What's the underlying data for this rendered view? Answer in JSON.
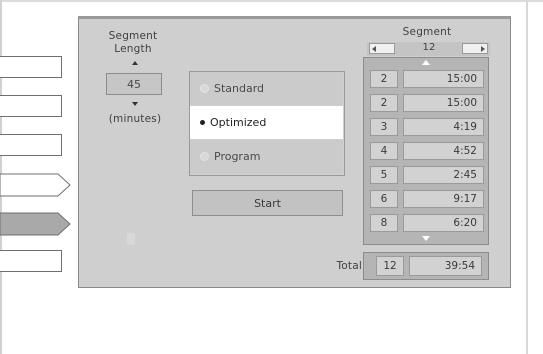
{
  "segment_length": {
    "title_line1": "Segment",
    "title_line2": "Length",
    "value": "45",
    "unit": "(minutes)"
  },
  "modes": [
    {
      "label": "Standard",
      "selected": false
    },
    {
      "label": "Optimized",
      "selected": true
    },
    {
      "label": "Program",
      "selected": false
    }
  ],
  "start_button": "Start",
  "segment": {
    "title": "Segment",
    "count": "12",
    "rows": [
      {
        "num": "2",
        "time": "15:00"
      },
      {
        "num": "2",
        "time": "15:00"
      },
      {
        "num": "3",
        "time": "4:19"
      },
      {
        "num": "4",
        "time": "4:52"
      },
      {
        "num": "5",
        "time": "2:45"
      },
      {
        "num": "6",
        "time": "9:17"
      },
      {
        "num": "8",
        "time": "6:20"
      }
    ],
    "total_label": "Total",
    "total_count": "12",
    "total_time": "39:54"
  },
  "colors": {
    "panel": "#cfcfcf",
    "selected_option": "#ffffff",
    "segment_column": "#b5b5b5"
  }
}
